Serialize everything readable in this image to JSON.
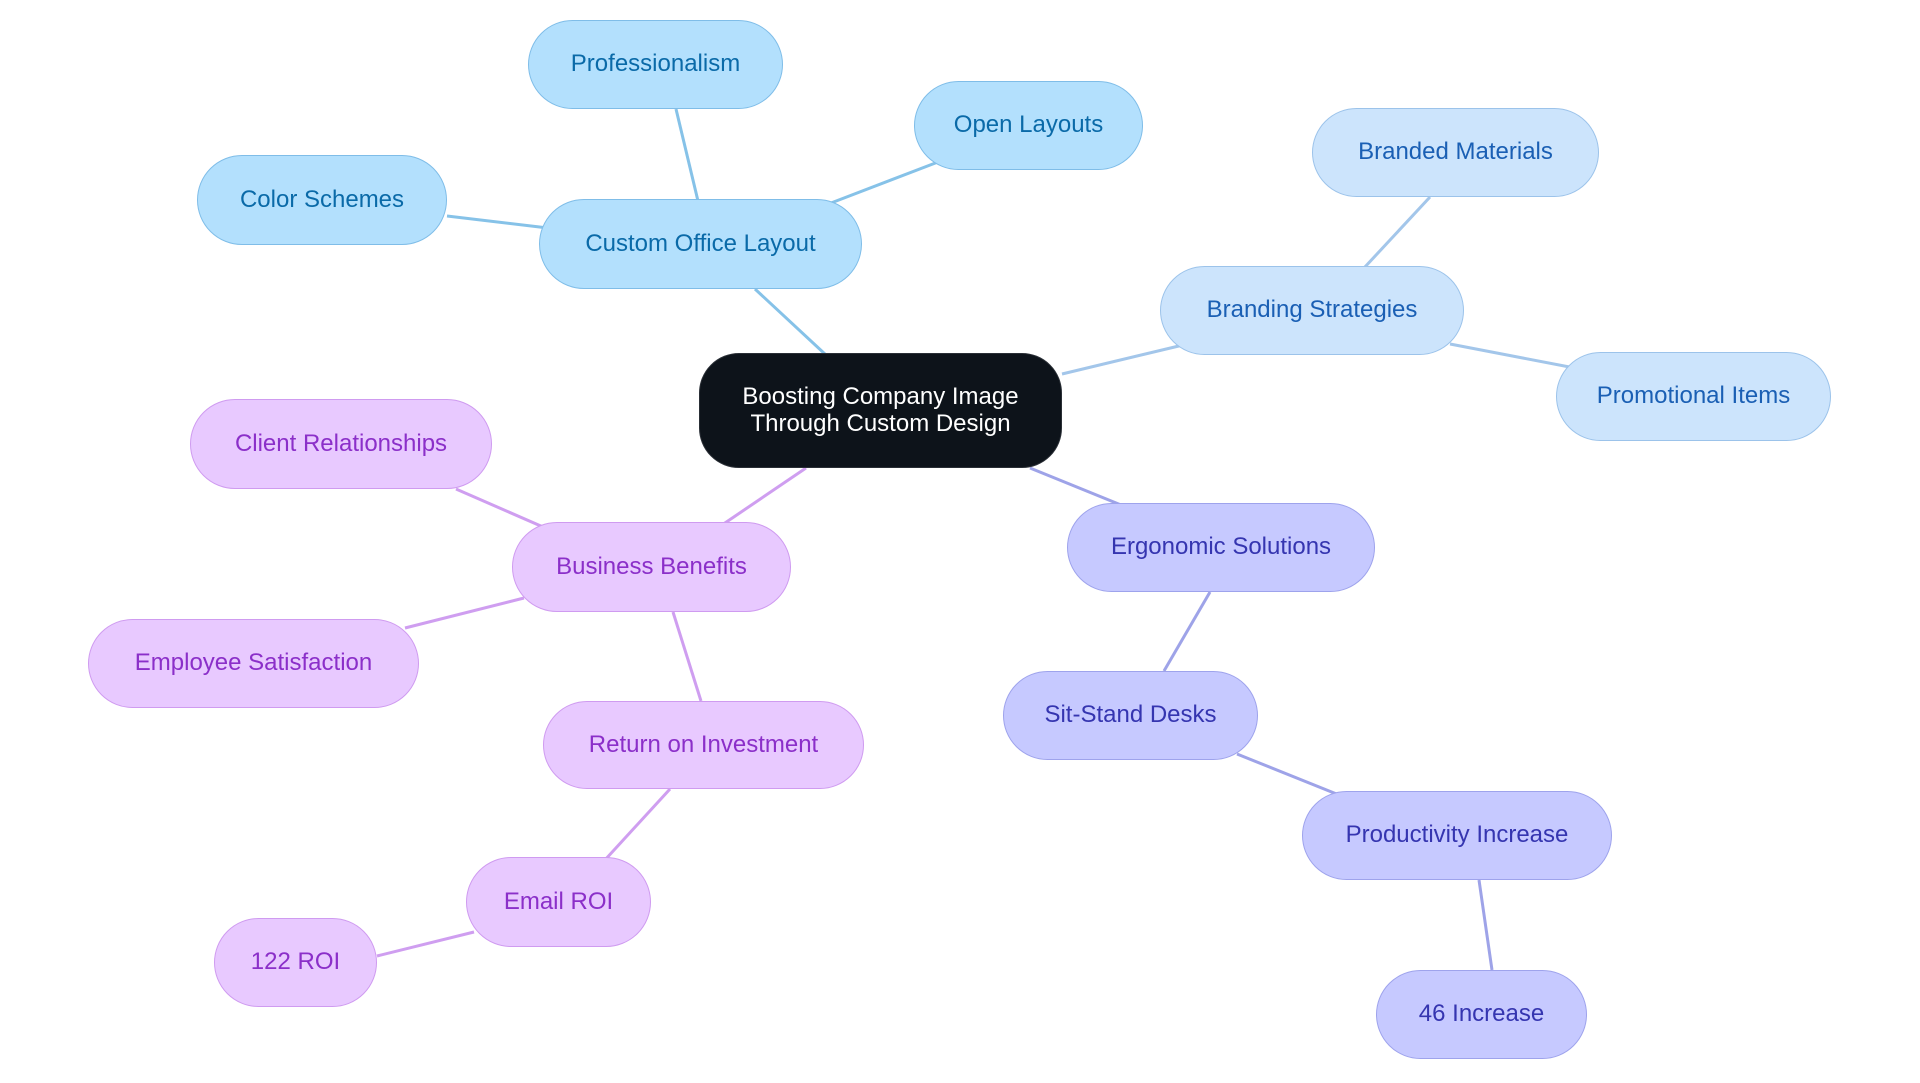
{
  "diagram": {
    "type": "mindmap",
    "root": {
      "id": "root",
      "label": "Boosting Company Image\nThrough Custom Design"
    },
    "colors": {
      "root_fill": "#0d131a",
      "root_text": "#ffffff",
      "blue": {
        "fill": "#b3e0fd",
        "stroke": "#7fbde8",
        "text": "#0a6aa8",
        "edge": "#86c2e8"
      },
      "light_blue": {
        "fill": "#cce4fc",
        "stroke": "#9cc3ea",
        "text": "#1a5fb4",
        "edge": "#a3c6ea"
      },
      "indigo": {
        "fill": "#c6c9ff",
        "stroke": "#9ea3ec",
        "text": "#3535b0",
        "edge": "#9ea3e8"
      },
      "purple": {
        "fill": "#e8c9ff",
        "stroke": "#cf9bf0",
        "text": "#8b2fc9",
        "edge": "#cf9ef0"
      }
    },
    "nodes": [
      {
        "id": "custom-office-layout",
        "label": "Custom Office Layout",
        "parent": "root",
        "family": "blue"
      },
      {
        "id": "professionalism",
        "label": "Professionalism",
        "parent": "custom-office-layout",
        "family": "blue"
      },
      {
        "id": "open-layouts",
        "label": "Open Layouts",
        "parent": "custom-office-layout",
        "family": "blue"
      },
      {
        "id": "color-schemes",
        "label": "Color Schemes",
        "parent": "custom-office-layout",
        "family": "blue"
      },
      {
        "id": "branding-strategies",
        "label": "Branding Strategies",
        "parent": "root",
        "family": "light_blue"
      },
      {
        "id": "branded-materials",
        "label": "Branded Materials",
        "parent": "branding-strategies",
        "family": "light_blue"
      },
      {
        "id": "promotional-items",
        "label": "Promotional Items",
        "parent": "branding-strategies",
        "family": "light_blue"
      },
      {
        "id": "ergonomic-solutions",
        "label": "Ergonomic Solutions",
        "parent": "root",
        "family": "indigo"
      },
      {
        "id": "sit-stand-desks",
        "label": "Sit-Stand Desks",
        "parent": "ergonomic-solutions",
        "family": "indigo"
      },
      {
        "id": "productivity-increase",
        "label": "Productivity Increase",
        "parent": "sit-stand-desks",
        "family": "indigo"
      },
      {
        "id": "46-increase",
        "label": "46 Increase",
        "parent": "productivity-increase",
        "family": "indigo"
      },
      {
        "id": "business-benefits",
        "label": "Business Benefits",
        "parent": "root",
        "family": "purple"
      },
      {
        "id": "client-relationships",
        "label": "Client Relationships",
        "parent": "business-benefits",
        "family": "purple"
      },
      {
        "id": "employee-satisfaction",
        "label": "Employee Satisfaction",
        "parent": "business-benefits",
        "family": "purple"
      },
      {
        "id": "return-on-investment",
        "label": "Return on Investment",
        "parent": "business-benefits",
        "family": "purple"
      },
      {
        "id": "email-roi",
        "label": "Email ROI",
        "parent": "return-on-investment",
        "family": "purple"
      },
      {
        "id": "122-roi",
        "label": "122 ROI",
        "parent": "email-roi",
        "family": "purple"
      }
    ]
  }
}
